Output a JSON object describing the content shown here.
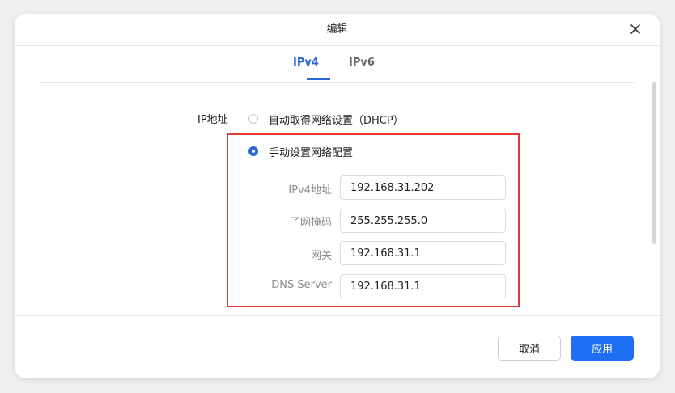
{
  "dialog": {
    "title": "编辑",
    "close_icon": "close-icon"
  },
  "tabs": [
    {
      "label": "IPv4",
      "active": true
    },
    {
      "label": "IPv6",
      "active": false
    }
  ],
  "ip_address": {
    "label": "IP地址",
    "options": [
      {
        "label": "自动取得网络设置（DHCP）",
        "selected": false
      },
      {
        "label": "手动设置网络配置",
        "selected": true
      }
    ]
  },
  "manual": {
    "ipv4_label": "IPv4地址",
    "ipv4_value": "192.168.31.202",
    "subnet_label": "子网掩码",
    "subnet_value": "255.255.255.0",
    "gateway_label": "网关",
    "gateway_value": "192.168.31.1",
    "dns_label": "DNS Server",
    "dns_value": "192.168.31.1"
  },
  "footer": {
    "cancel_label": "取消",
    "apply_label": "应用"
  },
  "colors": {
    "accent": "#2a66d8",
    "primary_button": "#1f6df2",
    "highlight_border": "#e53935"
  }
}
